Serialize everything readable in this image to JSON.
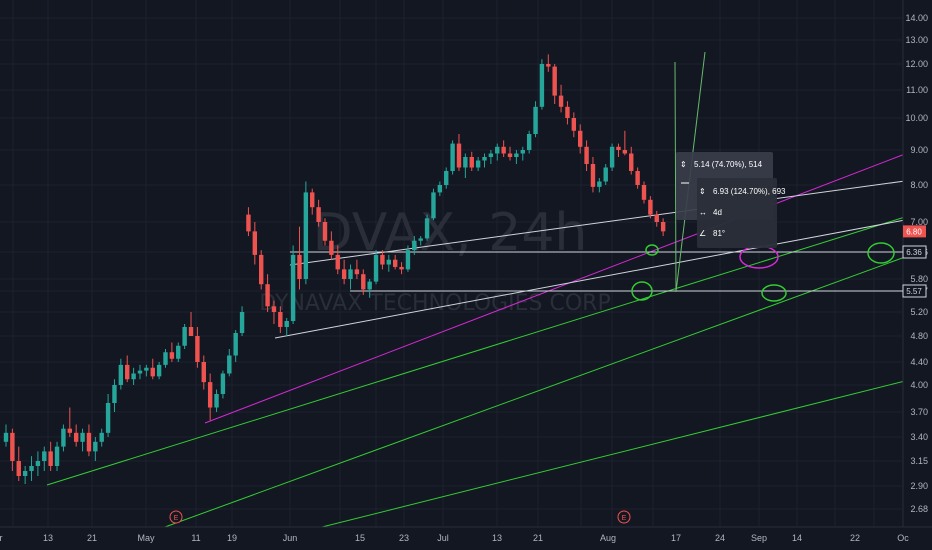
{
  "watermark": {
    "symbol": "DVAX, 24h",
    "company": "DYNAVAX TECHNOLOGIES CORP"
  },
  "chart_data": {
    "type": "candlestick",
    "symbol": "DVAX",
    "interval": "24h",
    "x_labels": [
      "r",
      "13",
      "21",
      "May",
      "11",
      "19",
      "Jun",
      "15",
      "23",
      "Jul",
      "13",
      "21",
      "Aug",
      "17",
      "24",
      "Sep",
      "14",
      "22",
      "Oc"
    ],
    "y_ticks": [
      "14.00",
      "13.00",
      "12.00",
      "11.00",
      "10.00",
      "9.00",
      "8.00",
      "7.00",
      "6.36",
      "5.80",
      "5.57",
      "5.20",
      "4.80",
      "4.40",
      "4.00",
      "3.70",
      "3.40",
      "3.15",
      "2.90",
      "2.68"
    ],
    "y_tick_values": [
      14,
      13,
      12,
      11,
      10,
      9,
      8,
      7,
      6.36,
      5.8,
      5.57,
      5.2,
      4.8,
      4.4,
      4.0,
      3.7,
      3.4,
      3.15,
      2.9,
      2.68
    ],
    "price_labels": [
      {
        "text": "6.80",
        "value": 6.8,
        "color": "#ef5350"
      },
      {
        "text": "6.36",
        "value": 6.36,
        "color": "#d1d4dc"
      },
      {
        "text": "5.57",
        "value": 5.57,
        "color": "#d1d4dc"
      }
    ],
    "candles": [
      [
        3.35,
        3.55,
        3.3,
        3.45
      ],
      [
        3.45,
        3.5,
        3.05,
        3.15
      ],
      [
        3.15,
        3.3,
        2.95,
        3.0
      ],
      [
        3.0,
        3.1,
        2.92,
        3.05
      ],
      [
        3.05,
        3.2,
        2.95,
        3.1
      ],
      [
        3.1,
        3.25,
        3.0,
        3.15
      ],
      [
        3.15,
        3.3,
        3.05,
        3.25
      ],
      [
        3.25,
        3.35,
        3.05,
        3.1
      ],
      [
        3.1,
        3.35,
        3.05,
        3.3
      ],
      [
        3.3,
        3.55,
        3.25,
        3.5
      ],
      [
        3.5,
        3.75,
        3.4,
        3.45
      ],
      [
        3.45,
        3.55,
        3.3,
        3.35
      ],
      [
        3.35,
        3.5,
        3.25,
        3.45
      ],
      [
        3.45,
        3.55,
        3.2,
        3.25
      ],
      [
        3.25,
        3.4,
        3.15,
        3.35
      ],
      [
        3.35,
        3.5,
        3.3,
        3.45
      ],
      [
        3.45,
        3.9,
        3.4,
        3.8
      ],
      [
        3.8,
        4.1,
        3.7,
        4.0
      ],
      [
        4.0,
        4.45,
        3.95,
        4.35
      ],
      [
        4.35,
        4.5,
        4.05,
        4.1
      ],
      [
        4.1,
        4.3,
        4.0,
        4.2
      ],
      [
        4.2,
        4.35,
        4.1,
        4.25
      ],
      [
        4.25,
        4.35,
        4.15,
        4.3
      ],
      [
        4.3,
        4.45,
        4.1,
        4.15
      ],
      [
        4.15,
        4.4,
        4.1,
        4.35
      ],
      [
        4.35,
        4.6,
        4.3,
        4.55
      ],
      [
        4.55,
        4.7,
        4.4,
        4.45
      ],
      [
        4.45,
        4.7,
        4.4,
        4.65
      ],
      [
        4.65,
        5.0,
        4.6,
        4.95
      ],
      [
        4.95,
        5.2,
        4.85,
        4.8
      ],
      [
        4.8,
        4.95,
        4.3,
        4.4
      ],
      [
        4.4,
        4.5,
        3.95,
        4.05
      ],
      [
        4.05,
        4.2,
        3.6,
        3.75
      ],
      [
        3.75,
        3.95,
        3.7,
        3.9
      ],
      [
        3.9,
        4.25,
        3.85,
        4.2
      ],
      [
        4.2,
        4.6,
        4.15,
        4.5
      ],
      [
        4.5,
        4.9,
        4.4,
        4.85
      ],
      [
        4.85,
        5.3,
        4.8,
        5.2
      ],
      [
        7.2,
        7.4,
        6.7,
        6.8
      ],
      [
        6.8,
        7.0,
        6.1,
        6.3
      ],
      [
        6.3,
        6.4,
        5.6,
        5.7
      ],
      [
        5.7,
        5.9,
        5.2,
        5.3
      ],
      [
        5.3,
        5.4,
        5.0,
        5.2
      ],
      [
        5.2,
        5.3,
        4.85,
        4.95
      ],
      [
        4.95,
        5.1,
        4.8,
        5.05
      ],
      [
        5.05,
        6.5,
        5.0,
        6.3
      ],
      [
        6.3,
        6.9,
        5.6,
        5.8
      ],
      [
        5.8,
        8.1,
        5.7,
        7.8
      ],
      [
        7.8,
        7.9,
        7.2,
        7.4
      ],
      [
        7.4,
        7.6,
        6.9,
        7.0
      ],
      [
        7.0,
        7.1,
        6.5,
        6.6
      ],
      [
        6.6,
        6.8,
        6.2,
        6.3
      ],
      [
        6.3,
        6.5,
        5.9,
        6.0
      ],
      [
        6.0,
        6.2,
        5.7,
        5.8
      ],
      [
        5.8,
        6.1,
        5.6,
        6.0
      ],
      [
        6.0,
        6.2,
        5.8,
        5.9
      ],
      [
        5.9,
        6.0,
        5.5,
        5.6
      ],
      [
        5.6,
        5.8,
        5.45,
        5.75
      ],
      [
        5.75,
        6.4,
        5.7,
        6.3
      ],
      [
        6.3,
        6.4,
        6.0,
        6.1
      ],
      [
        6.1,
        6.3,
        5.95,
        6.2
      ],
      [
        6.2,
        6.3,
        6.0,
        6.05
      ],
      [
        6.05,
        6.15,
        5.9,
        6.0
      ],
      [
        6.0,
        6.5,
        5.95,
        6.4
      ],
      [
        6.4,
        6.7,
        6.3,
        6.6
      ],
      [
        6.6,
        6.7,
        6.5,
        6.65
      ],
      [
        6.65,
        7.2,
        6.6,
        7.1
      ],
      [
        7.1,
        7.9,
        7.05,
        7.8
      ],
      [
        7.8,
        8.1,
        7.7,
        8.0
      ],
      [
        8.0,
        8.5,
        7.9,
        8.4
      ],
      [
        8.4,
        9.3,
        8.3,
        9.2
      ],
      [
        9.2,
        9.5,
        8.4,
        8.5
      ],
      [
        8.5,
        8.9,
        8.2,
        8.8
      ],
      [
        8.8,
        8.95,
        8.4,
        8.5
      ],
      [
        8.5,
        8.8,
        8.4,
        8.7
      ],
      [
        8.7,
        8.9,
        8.5,
        8.8
      ],
      [
        8.8,
        9.0,
        8.6,
        8.9
      ],
      [
        8.9,
        9.2,
        8.7,
        9.1
      ],
      [
        9.1,
        9.3,
        8.8,
        8.9
      ],
      [
        8.9,
        9.1,
        8.7,
        8.8
      ],
      [
        8.8,
        9.0,
        8.6,
        8.9
      ],
      [
        8.9,
        9.1,
        8.7,
        9.0
      ],
      [
        9.0,
        9.6,
        8.9,
        9.5
      ],
      [
        9.5,
        10.6,
        9.4,
        10.4
      ],
      [
        10.4,
        12.2,
        10.3,
        12.0
      ],
      [
        12.0,
        12.4,
        11.7,
        11.9
      ],
      [
        11.9,
        12.0,
        10.5,
        10.8
      ],
      [
        10.8,
        11.2,
        10.2,
        10.4
      ],
      [
        10.4,
        10.6,
        9.8,
        10.0
      ],
      [
        10.0,
        10.2,
        9.4,
        9.6
      ],
      [
        9.6,
        9.8,
        8.9,
        9.1
      ],
      [
        9.1,
        9.3,
        8.4,
        8.6
      ],
      [
        8.6,
        8.8,
        7.8,
        7.95
      ],
      [
        7.95,
        8.2,
        7.8,
        8.1
      ],
      [
        8.1,
        8.6,
        8.0,
        8.5
      ],
      [
        8.5,
        9.2,
        8.4,
        9.1
      ],
      [
        9.1,
        9.2,
        8.8,
        9.0
      ],
      [
        9.0,
        9.6,
        8.85,
        8.9
      ],
      [
        8.9,
        9.1,
        8.3,
        8.4
      ],
      [
        8.4,
        8.5,
        7.9,
        8.0
      ],
      [
        8.0,
        8.1,
        7.5,
        7.6
      ],
      [
        7.6,
        7.7,
        7.1,
        7.2
      ],
      [
        7.2,
        7.3,
        6.9,
        7.0
      ],
      [
        7.0,
        7.1,
        6.7,
        6.8
      ]
    ],
    "annotations": [
      {
        "text": "5.14 (74.70%), 514"
      },
      {
        "text": "6.93 (124.70%), 693"
      },
      {
        "text": "4d"
      },
      {
        "text": "81°"
      }
    ],
    "earnings_markers": [
      "E",
      "E"
    ]
  }
}
